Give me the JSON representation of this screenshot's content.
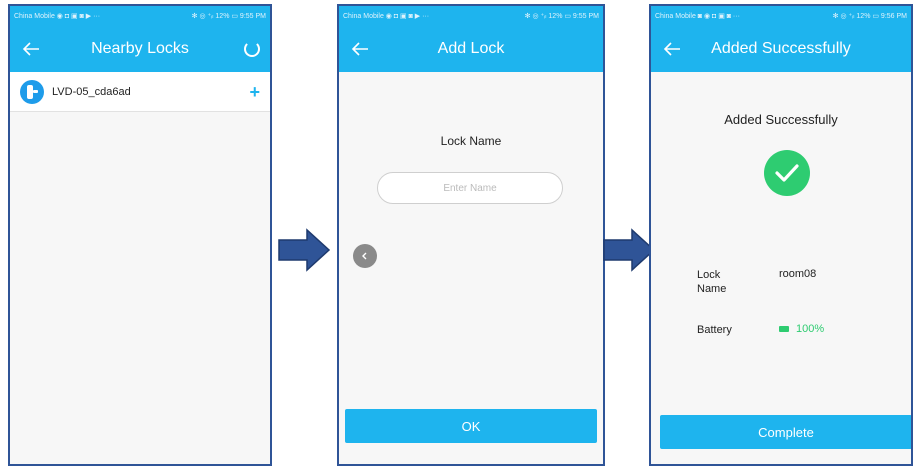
{
  "phone1": {
    "status_left": "China Mobile ◉ ◘ ▣ ◙ ▶ ···",
    "status_right": "✻ ◎ ⁺ᵢₗ 12% ▭ 9:55 PM",
    "title": "Nearby Locks",
    "locks": [
      {
        "name": "LVD-05_cda6ad",
        "add_label": "+"
      }
    ]
  },
  "phone2": {
    "status_left": "China Mobile ◉ ◘ ▣ ◙ ▶ ···",
    "status_right": "✻ ◎ ⁺ᵢₗ 12% ▭ 9:55 PM",
    "title": "Add Lock",
    "lock_name_label": "Lock Name",
    "input_placeholder": "Enter Name",
    "ok_label": "OK"
  },
  "phone3": {
    "status_left": "China Mobile ◙ ◉ ◘ ▣ ◙ ···",
    "status_right": "✻ ◎ ⁺ᵢₗ 12% ▭ 9:56 PM",
    "title": "Added Successfully",
    "heading": "Added Successfully",
    "lock_name_label": "Lock Name",
    "lock_name_value": "room08",
    "battery_label": "Battery",
    "battery_value": "100%",
    "complete_label": "Complete"
  },
  "colors": {
    "accent": "#1eb4ee",
    "border": "#2f5497",
    "success": "#2ecc71",
    "arrow": "#2f5497"
  },
  "icons": [
    "back-arrow-icon",
    "refresh-spinner-icon",
    "lock-icon",
    "add-icon",
    "chevron-left-icon",
    "checkmark-icon",
    "battery-icon",
    "flow-arrow-icon"
  ]
}
